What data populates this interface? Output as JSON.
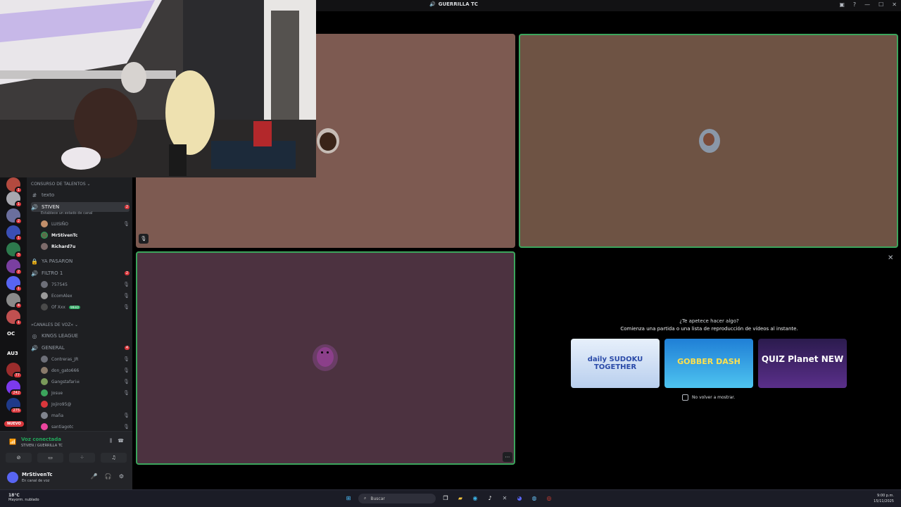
{
  "window": {
    "title": "GUERRILLA TC"
  },
  "servers": {
    "items": [
      {
        "badge": "1",
        "color": "#b34a3f"
      },
      {
        "badge": "1",
        "color": "#a8a8b0"
      },
      {
        "badge": "2",
        "color": "#6b6f9e"
      },
      {
        "badge": "1",
        "color": "#3a4fb5"
      },
      {
        "badge": "3",
        "color": "#2d7a4d"
      },
      {
        "badge": "2",
        "color": "#7a3fa0"
      },
      {
        "badge": "1",
        "color": "#5865f2"
      },
      {
        "badge": "4",
        "color": "#8a8a8a"
      },
      {
        "badge": "1",
        "color": "#c05050"
      },
      {
        "badge": "1",
        "color": "#222222"
      },
      {
        "badge": "77",
        "color": "#9b2c2c"
      },
      {
        "badge": "242",
        "color": "#7c3aed"
      },
      {
        "badge": "275",
        "color": "#1f3a8a"
      }
    ],
    "oc_label": "OC",
    "au_label": "AU3",
    "new_label": "NUEVO"
  },
  "channels": {
    "category_talents": "CONSURSO DE TALENTOS ⌄",
    "texto": "texto",
    "stiven": {
      "name": "STIVEN",
      "count": "2",
      "status": "Establece un estado de canal"
    },
    "stiven_users": [
      "LUISIÑO",
      "MrStivenTc",
      "Richard7u"
    ],
    "ya_pasaron": "YA PASARON",
    "filtro": {
      "name": "FILTRO 1",
      "count": "2"
    },
    "filtro_users": [
      "757545",
      "EcomAlex",
      "Of Xxx"
    ],
    "filtro_tag": "WEED",
    "category_voice": "»CANALES DE VOZ« ⌄",
    "kings": "KINGS LEAGUE",
    "general": {
      "name": "GENERAL",
      "count": "4"
    },
    "general_users": [
      "Contreras_JR",
      "don_gato666",
      "Gangstafari☠",
      "Josue",
      "Jojiro95@",
      "maña",
      "santiagotc"
    ]
  },
  "voice": {
    "status": "Voz conectada",
    "location": "STIVEN / GUERRILLA TC"
  },
  "user": {
    "name": "MrStivenTc",
    "status": "En canal de voz"
  },
  "activity": {
    "question": "¿Te apetece hacer algo?",
    "subtitle": "Comienza una partida o una lista de reproducción de vídeos al instante.",
    "games": [
      {
        "name": "daily SUDOKU TOGETHER"
      },
      {
        "name": "GOBBER DASH"
      },
      {
        "name": "QUIZ Planet NEW"
      }
    ],
    "dont_show": "No volver a mostrar."
  },
  "taskbar": {
    "temp": "18°C",
    "weather": "Mayorm. nublado",
    "search": "Buscar",
    "time": "9:00 p.m.",
    "date": "15/11/2025"
  },
  "colors": {
    "accent_green": "#23a55a",
    "badge_red": "#da373c",
    "blurple": "#5865f2"
  }
}
